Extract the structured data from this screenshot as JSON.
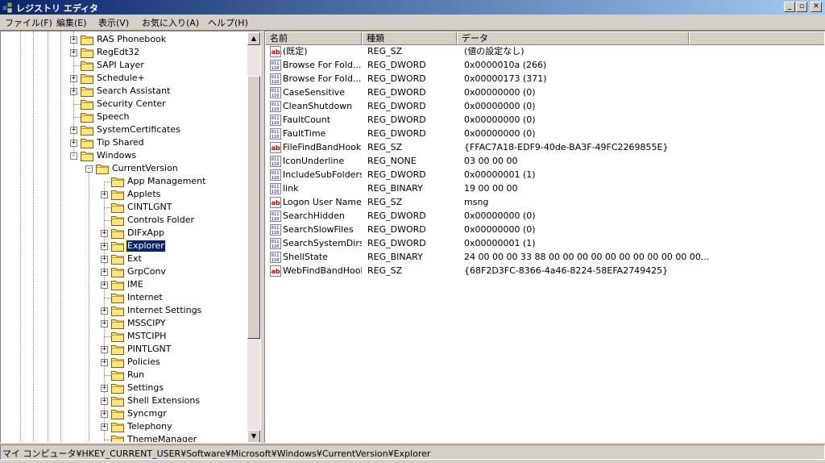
{
  "window": {
    "title": "レジストリ エディタ",
    "minimize": "_",
    "maximize": "▫",
    "close": "✕"
  },
  "menu": [
    "ファイル(F)",
    "編集(E)",
    "表示(V)",
    "お気に入り(A)",
    "ヘルプ(H)"
  ],
  "tree": [
    {
      "label": "RAS Phonebook",
      "indent": 0,
      "expander": "+"
    },
    {
      "label": "RegEdt32",
      "indent": 0,
      "expander": "+"
    },
    {
      "label": "SAPI Layer",
      "indent": 0,
      "expander": ""
    },
    {
      "label": "Schedule+",
      "indent": 0,
      "expander": "+"
    },
    {
      "label": "Search Assistant",
      "indent": 0,
      "expander": "+"
    },
    {
      "label": "Security Center",
      "indent": 0,
      "expander": ""
    },
    {
      "label": "Speech",
      "indent": 0,
      "expander": ""
    },
    {
      "label": "SystemCertificates",
      "indent": 0,
      "expander": "+"
    },
    {
      "label": "Tip Shared",
      "indent": 0,
      "expander": "+"
    },
    {
      "label": "Windows",
      "indent": 0,
      "expander": "-"
    },
    {
      "label": "CurrentVersion",
      "indent": 1,
      "expander": "-"
    },
    {
      "label": "App Management",
      "indent": 2,
      "expander": ""
    },
    {
      "label": "Applets",
      "indent": 2,
      "expander": "+"
    },
    {
      "label": "CINTLGNT",
      "indent": 2,
      "expander": ""
    },
    {
      "label": "Controls Folder",
      "indent": 2,
      "expander": ""
    },
    {
      "label": "DIFxApp",
      "indent": 2,
      "expander": "+"
    },
    {
      "label": "Explorer",
      "indent": 2,
      "expander": "+",
      "selected": true
    },
    {
      "label": "Ext",
      "indent": 2,
      "expander": "+"
    },
    {
      "label": "GrpConv",
      "indent": 2,
      "expander": "+"
    },
    {
      "label": "IME",
      "indent": 2,
      "expander": "+"
    },
    {
      "label": "Internet",
      "indent": 2,
      "expander": ""
    },
    {
      "label": "Internet Settings",
      "indent": 2,
      "expander": "+"
    },
    {
      "label": "MSSCIPY",
      "indent": 2,
      "expander": "+"
    },
    {
      "label": "MSTCIPH",
      "indent": 2,
      "expander": ""
    },
    {
      "label": "PINTLGNT",
      "indent": 2,
      "expander": "+"
    },
    {
      "label": "Policies",
      "indent": 2,
      "expander": "+"
    },
    {
      "label": "Run",
      "indent": 2,
      "expander": ""
    },
    {
      "label": "Settings",
      "indent": 2,
      "expander": "+"
    },
    {
      "label": "Shell Extensions",
      "indent": 2,
      "expander": "+"
    },
    {
      "label": "Syncmgr",
      "indent": 2,
      "expander": "+"
    },
    {
      "label": "Telephony",
      "indent": 2,
      "expander": "+"
    },
    {
      "label": "ThemeManager",
      "indent": 2,
      "expander": ""
    }
  ],
  "columns": [
    "名前",
    "種類",
    "データ"
  ],
  "values": [
    {
      "name": "(既定)",
      "type": "REG_SZ",
      "data": "(値の設定なし)",
      "icon": "string-value-icon"
    },
    {
      "name": "Browse For Fold...",
      "type": "REG_DWORD",
      "data": "0x0000010a (266)",
      "icon": "binary-value-icon"
    },
    {
      "name": "Browse For Fold...",
      "type": "REG_DWORD",
      "data": "0x00000173 (371)",
      "icon": "binary-value-icon"
    },
    {
      "name": "CaseSensitive",
      "type": "REG_DWORD",
      "data": "0x00000000 (0)",
      "icon": "binary-value-icon"
    },
    {
      "name": "CleanShutdown",
      "type": "REG_DWORD",
      "data": "0x00000000 (0)",
      "icon": "binary-value-icon"
    },
    {
      "name": "FaultCount",
      "type": "REG_DWORD",
      "data": "0x00000000 (0)",
      "icon": "binary-value-icon"
    },
    {
      "name": "FaultTime",
      "type": "REG_DWORD",
      "data": "0x00000000 (0)",
      "icon": "binary-value-icon"
    },
    {
      "name": "FileFindBandHook",
      "type": "REG_SZ",
      "data": "{FFAC7A18-EDF9-40de-BA3F-49FC2269855E}",
      "icon": "string-value-icon"
    },
    {
      "name": "IconUnderline",
      "type": "REG_NONE",
      "data": "03 00 00 00",
      "icon": "binary-value-icon"
    },
    {
      "name": "IncludeSubFolders",
      "type": "REG_DWORD",
      "data": "0x00000001 (1)",
      "icon": "binary-value-icon"
    },
    {
      "name": "link",
      "type": "REG_BINARY",
      "data": "19 00 00 00",
      "icon": "binary-value-icon"
    },
    {
      "name": "Logon User Name",
      "type": "REG_SZ",
      "data": "msng",
      "icon": "string-value-icon"
    },
    {
      "name": "SearchHidden",
      "type": "REG_DWORD",
      "data": "0x00000000 (0)",
      "icon": "binary-value-icon"
    },
    {
      "name": "SearchSlowFiles",
      "type": "REG_DWORD",
      "data": "0x00000000 (0)",
      "icon": "binary-value-icon"
    },
    {
      "name": "SearchSystemDirs",
      "type": "REG_DWORD",
      "data": "0x00000001 (1)",
      "icon": "binary-value-icon"
    },
    {
      "name": "ShellState",
      "type": "REG_BINARY",
      "data": "24 00 00 00 33 88 00 00 00 00 00 00 00 00 00 00 00...",
      "icon": "binary-value-icon"
    },
    {
      "name": "WebFindBandHook",
      "type": "REG_SZ",
      "data": "{68F2D3FC-8366-4a46-8224-58EFA2749425}",
      "icon": "string-value-icon"
    }
  ],
  "status": "マイ コンピュータ¥HKEY_CURRENT_USER¥Software¥Microsoft¥Windows¥CurrentVersion¥Explorer",
  "icons": {
    "app": "registry-editor-icon",
    "folder": "folder-icon",
    "scroll_up": "▲",
    "scroll_down": "▼"
  },
  "colors": {
    "selection": "#0a246a",
    "title_start": "#0a246a",
    "title_end": "#a6caf0"
  }
}
